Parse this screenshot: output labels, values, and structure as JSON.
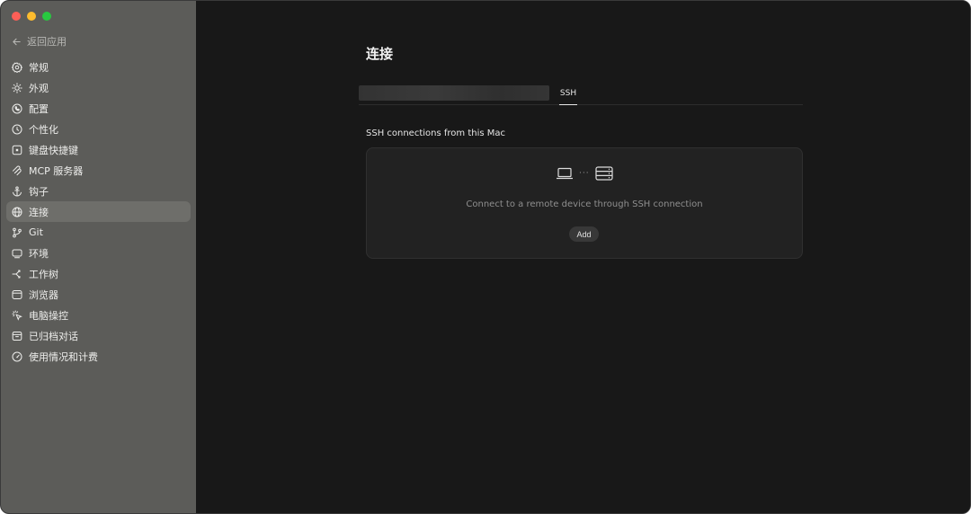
{
  "window": {
    "colors": {
      "sidebar": "#5c5c59",
      "main": "#181818",
      "active_item": "#6e6e6a"
    }
  },
  "sidebar": {
    "back_label": "返回应用",
    "items": [
      {
        "label": "常规",
        "icon": "gear-icon"
      },
      {
        "label": "外观",
        "icon": "sun-icon"
      },
      {
        "label": "配置",
        "icon": "config-icon"
      },
      {
        "label": "个性化",
        "icon": "personalize-icon"
      },
      {
        "label": "键盘快捷键",
        "icon": "keyboard-icon"
      },
      {
        "label": "MCP 服务器",
        "icon": "mcp-icon"
      },
      {
        "label": "钩子",
        "icon": "anchor-icon"
      },
      {
        "label": "连接",
        "icon": "globe-icon",
        "active": true
      },
      {
        "label": "Git",
        "icon": "git-branch-icon"
      },
      {
        "label": "环境",
        "icon": "monitor-icon"
      },
      {
        "label": "工作树",
        "icon": "worktree-icon"
      },
      {
        "label": "浏览器",
        "icon": "browser-icon"
      },
      {
        "label": "电脑操控",
        "icon": "cursor-click-icon"
      },
      {
        "label": "已归档对话",
        "icon": "archive-icon"
      },
      {
        "label": "使用情况和计费",
        "icon": "gauge-icon"
      }
    ]
  },
  "main": {
    "title": "连接",
    "tabs": {
      "ssh": "SSH"
    },
    "section_label": "SSH connections from this Mac",
    "card": {
      "dots": "···",
      "description": "Connect to a remote device through SSH connection",
      "add_label": "Add"
    }
  }
}
